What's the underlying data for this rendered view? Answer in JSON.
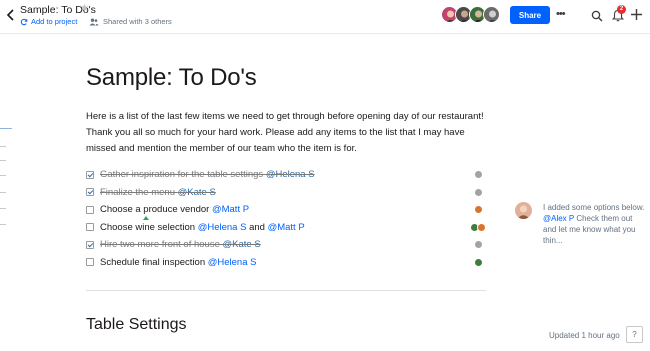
{
  "header": {
    "doc_title": "Sample: To Do's",
    "add_to_project": "Add to project",
    "shared_with": "Shared with 3 others",
    "share_label": "Share",
    "more_label": "•••",
    "notification_count": "2",
    "collaborators": [
      {
        "name": "collaborator-1",
        "color": "#c0446b"
      },
      {
        "name": "collaborator-2",
        "color": "#4a4a4a"
      },
      {
        "name": "collaborator-3",
        "color": "#3a6e3a"
      },
      {
        "name": "collaborator-4",
        "color": "#6b6b6b"
      }
    ]
  },
  "document": {
    "title": "Sample: To Do's",
    "intro": "Here is a list of the last few items we need to get through before opening day of our restaurant! Thank you all so much for your hard work. Please add any items to the list that I may have missed and mention the member of our team who the item is for.",
    "todos": [
      {
        "text": "Gather inspiration for the table settings ",
        "mention": "@Helena S",
        "done": true,
        "extra": "",
        "mention2": ""
      },
      {
        "text": "Finalize the menu ",
        "mention": "@Kate S",
        "done": true,
        "extra": "",
        "mention2": ""
      },
      {
        "text": "Choose a produce vendor ",
        "mention": "@Matt P",
        "done": false,
        "extra": "",
        "mention2": ""
      },
      {
        "text": "Choose wine selection ",
        "mention": "@Helena S",
        "done": false,
        "extra": " and ",
        "mention2": "@Matt P"
      },
      {
        "text": "Hire two more front of house ",
        "mention": "@Kate S",
        "done": true,
        "extra": "",
        "mention2": ""
      },
      {
        "text": "Schedule final inspection ",
        "mention": "@Helena S",
        "done": false,
        "extra": "",
        "mention2": ""
      }
    ],
    "section_heading": "Table Settings"
  },
  "comment": {
    "before": "I added some options below. ",
    "mention": "@Alex P",
    "after": " Check them out and let me know what you thin..."
  },
  "footer": {
    "updated": "Updated 1 hour ago",
    "help": "?"
  },
  "colors": {
    "accent": "#0061fe",
    "heading": "#1e1919",
    "muted": "#637282"
  }
}
